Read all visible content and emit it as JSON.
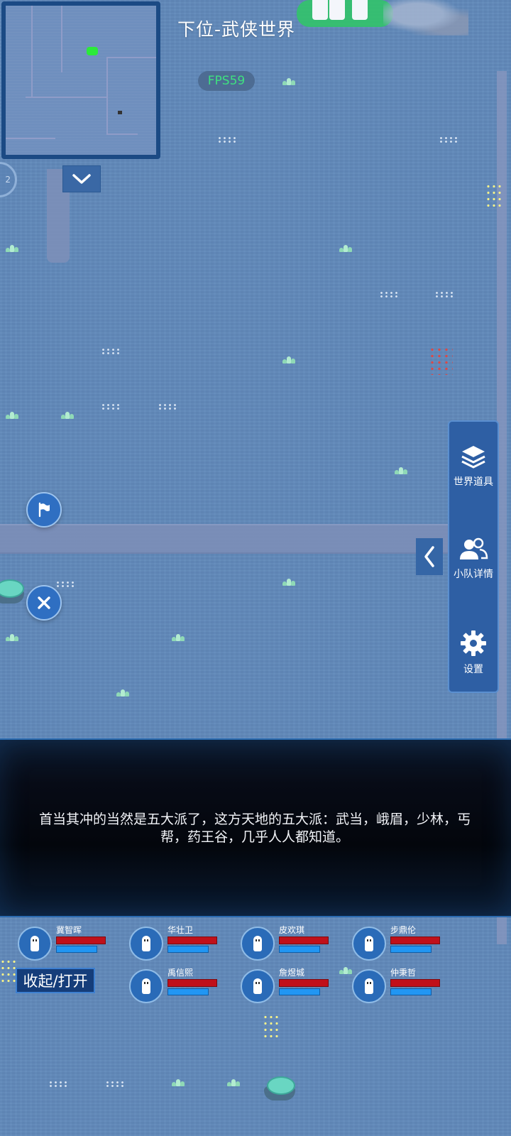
{
  "world": {
    "title": "下位-武侠世界",
    "fps": "FPS59",
    "zoom_label": "2"
  },
  "side_panel": {
    "items": [
      {
        "label": "世界道具",
        "icon": "layers-icon"
      },
      {
        "label": "小队详情",
        "icon": "team-icon"
      },
      {
        "label": "设置",
        "icon": "gear-icon"
      }
    ]
  },
  "dialog": {
    "text": "首当其冲的当然是五大派了，这方天地的五大派：武当，峨眉，少林，丐帮，药王谷，几乎人人都知道。"
  },
  "squad": {
    "members": [
      {
        "name": "冀智晖",
        "hp": 1.0,
        "mp": 0.82
      },
      {
        "name": "华壮卫",
        "hp": 1.0,
        "mp": 0.82
      },
      {
        "name": "皮欢琪",
        "hp": 1.0,
        "mp": 0.82
      },
      {
        "name": "步鼎伦",
        "hp": 1.0,
        "mp": 0.82
      },
      {
        "name": "禹信熙",
        "hp": 1.0,
        "mp": 0.82
      },
      {
        "name": "詹煜城",
        "hp": 1.0,
        "mp": 0.82
      },
      {
        "name": "仲秉哲",
        "hp": 1.0,
        "mp": 0.82
      }
    ],
    "toggle_label": "收起/打开"
  },
  "colors": {
    "water": "#6189ba",
    "panel": "#2e5fa4",
    "hp": "#c0101a",
    "mp": "#2196f3",
    "fps_text": "#3fe080"
  }
}
